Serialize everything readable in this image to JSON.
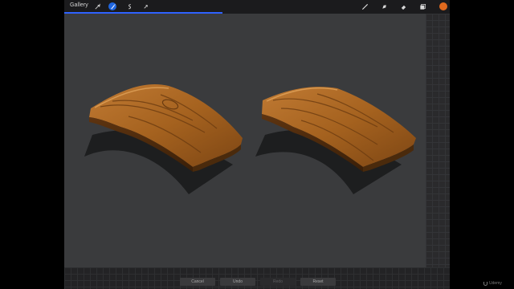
{
  "topbar": {
    "gallery_label": "Gallery",
    "left_tools": [
      "wrench-icon",
      "magic-wand-icon",
      "selection-icon",
      "transform-arrow-icon"
    ],
    "right_tools": [
      "brush-icon",
      "smudge-icon",
      "eraser-icon",
      "layers-icon"
    ],
    "active_tool": "magic-wand-icon",
    "progress_percent": 41,
    "accent_color": "#2f62ff",
    "active_tool_color": "#1f66e0",
    "current_color": "#e06a1e"
  },
  "canvas": {
    "background": "#3a3b3d",
    "artwork": [
      "wood-plank-left",
      "wood-plank-right"
    ]
  },
  "bottombar": {
    "cancel_label": "Cancel",
    "undo_label": "Undo",
    "redo_label": "Redo",
    "reset_label": "Reset"
  },
  "watermark": {
    "text": "Udemy"
  }
}
